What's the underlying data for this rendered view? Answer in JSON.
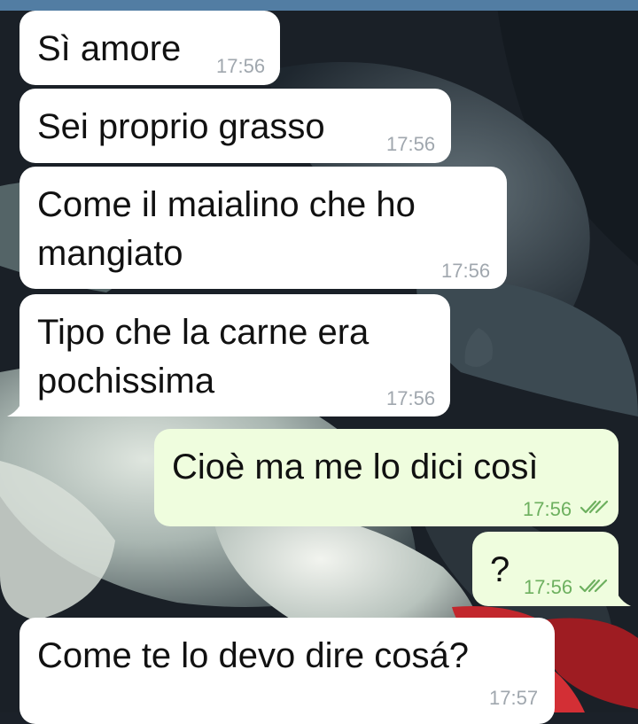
{
  "status_bar_color": "#527da3",
  "colors": {
    "incoming_bubble": "#ffffff",
    "outgoing_bubble": "#effdde",
    "incoming_time": "#a0a7ae",
    "outgoing_time": "#6db05f",
    "read_ticks": "#6db05f"
  },
  "messages": [
    {
      "direction": "in",
      "text": "Sì amore",
      "time": "17:56"
    },
    {
      "direction": "in",
      "text": "Sei proprio grasso",
      "time": "17:56"
    },
    {
      "direction": "in",
      "text_lines": [
        "Come il maialino che ho",
        "mangiato"
      ],
      "time": "17:56"
    },
    {
      "direction": "in",
      "text_lines": [
        "Tipo che la carne era",
        "pochissima"
      ],
      "time": "17:56"
    },
    {
      "direction": "out",
      "text": "Cioè ma me lo dici così",
      "time": "17:56",
      "status_icon": "double-check-icon"
    },
    {
      "direction": "out",
      "text": "?",
      "time": "17:56",
      "status_icon": "double-check-icon"
    },
    {
      "direction": "in",
      "text": "Come te lo devo dire cosá?",
      "time": "17:57"
    }
  ]
}
